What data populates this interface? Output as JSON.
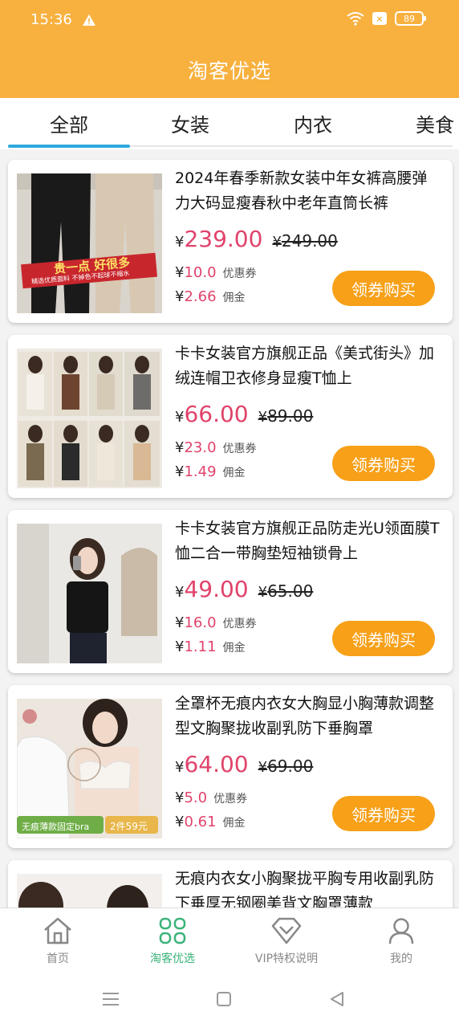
{
  "status": {
    "time": "15:36",
    "battery": "89",
    "sim": "×"
  },
  "header": {
    "title": "淘客优选"
  },
  "tabs": [
    {
      "label": "全部",
      "active": true
    },
    {
      "label": "女装",
      "active": false
    },
    {
      "label": "内衣",
      "active": false
    },
    {
      "label": "美食",
      "active": false
    }
  ],
  "products": [
    {
      "title": "2024年春季新款女装中年女裤高腰弹力大码显瘦春秋中老年直筒长裤",
      "currency": "¥",
      "price": "239.00",
      "original": "249.00",
      "coupon": "10.0",
      "coupon_label": "优惠券",
      "commission": "2.66",
      "commission_label": "佣金",
      "button": "领券购买",
      "image_text": "贵一点 好很多",
      "image_subtext": "精选优质面料 不掉色不起球不缩水"
    },
    {
      "title": "卡卡女装官方旗舰正品《美式街头》加绒连帽卫衣修身显瘦T恤上",
      "currency": "¥",
      "price": "66.00",
      "original": "89.00",
      "coupon": "23.0",
      "coupon_label": "优惠券",
      "commission": "1.49",
      "commission_label": "佣金",
      "button": "领券购买",
      "image_text": "",
      "image_subtext": ""
    },
    {
      "title": "卡卡女装官方旗舰正品防走光U领面膜T恤二合一带胸垫短袖锁骨上",
      "currency": "¥",
      "price": "49.00",
      "original": "65.00",
      "coupon": "16.0",
      "coupon_label": "优惠券",
      "commission": "1.11",
      "commission_label": "佣金",
      "button": "领券购买",
      "image_text": "",
      "image_subtext": ""
    },
    {
      "title": "全罩杯无痕内衣女大胸显小胸薄款调整型文胸聚拢收副乳防下垂胸罩",
      "currency": "¥",
      "price": "64.00",
      "original": "69.00",
      "coupon": "5.0",
      "coupon_label": "优惠券",
      "commission": "0.61",
      "commission_label": "佣金",
      "button": "领券购买",
      "image_text": "无痕薄款固定bra",
      "image_subtext": "2件59元"
    },
    {
      "title": "无痕内衣女小胸聚拢平胸专用收副乳防下垂厚无钢圈美背文胸罩薄款"
    }
  ],
  "nav": [
    {
      "label": "首页",
      "icon": "home-icon",
      "active": false
    },
    {
      "label": "淘客优选",
      "icon": "grid-icon",
      "active": true
    },
    {
      "label": "VIP特权说明",
      "icon": "diamond-icon",
      "active": false
    },
    {
      "label": "我的",
      "icon": "user-icon",
      "active": false
    }
  ],
  "colors": {
    "brand": "#F8B13F",
    "button": "#F7A018",
    "price": "#E0436B",
    "active_nav": "#3BB37A",
    "tab_indicator": "#2ea9dc"
  }
}
